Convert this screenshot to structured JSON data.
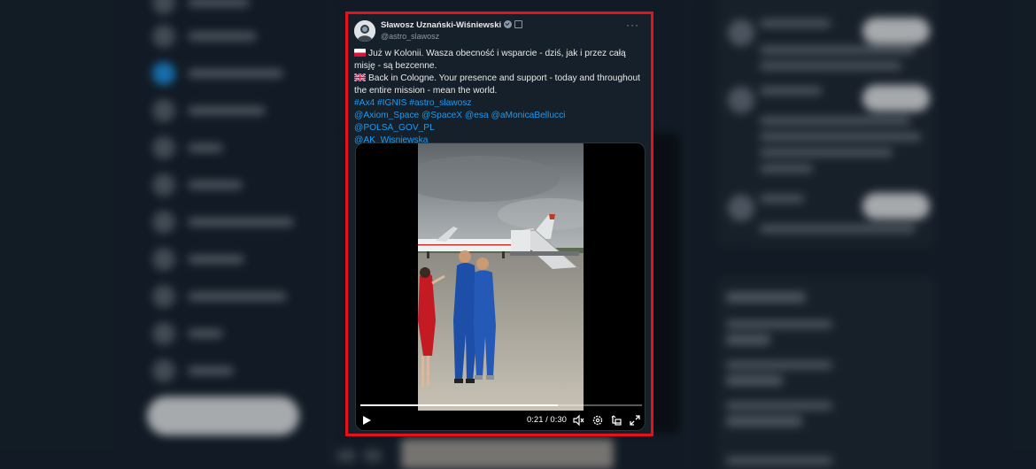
{
  "tweet": {
    "author_name": "Sławosz Uznański-Wiśniewski",
    "handle": "@astro_slawosz",
    "more_label": "···",
    "text_pl": "Już w Kolonii. Wasza obecność i wsparcie - dziś, jak i przez całą misję - są bezcenne.",
    "text_en": "Back in Cologne. Your presence and support - today and throughout the entire mission - mean the world.",
    "hashtags": "#Ax4 #IGNIS #astro_slawosz",
    "mentions_line1": "@Axiom_Space @SpaceX @esa @aMonicaBellucci @POLSA_GOV_PL",
    "mentions_line2": "@AK_Wisniewska"
  },
  "video": {
    "current_time": "0:21",
    "duration": "0:30",
    "time_label": "0:21 / 0:30",
    "progress": 0.7
  },
  "colors": {
    "highlight_border": "#e8101a",
    "link": "#1d9bf0",
    "background": "#15202b"
  },
  "icons": {
    "play": "play-icon",
    "volume": "volume-muted-icon",
    "settings": "settings-icon",
    "pip": "picture-in-picture-icon",
    "fullscreen": "fullscreen-icon"
  }
}
